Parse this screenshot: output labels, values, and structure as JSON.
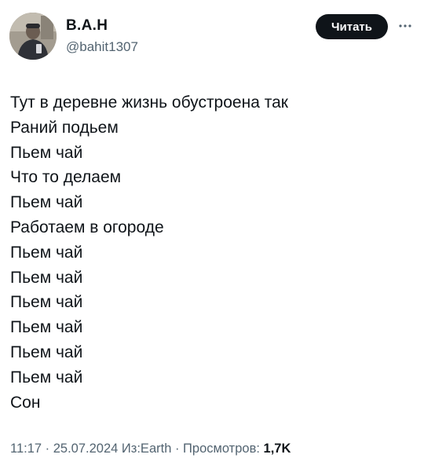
{
  "author": {
    "display_name": "В.А.Н",
    "handle": "@bahit1307",
    "avatar_icon": "user-avatar-photo"
  },
  "header": {
    "follow_label": "Читать",
    "more_icon": "more-dots-icon"
  },
  "tweet": {
    "lines": [
      "Тут в деревне жизнь обустроена так",
      "Раний подьем",
      "Пьем чай",
      "Что то делаем",
      "Пьем чай",
      "Работаем в огороде",
      "Пьем чай",
      "Пьем чай",
      "Пьем чай",
      "Пьем чай",
      "Пьем чай",
      "Пьем чай",
      "Сон"
    ]
  },
  "meta": {
    "time": "11:17",
    "separator1": " · ",
    "date": "25.07.2024",
    "location": " Из:Earth",
    "separator2": " · ",
    "views_label": "Просмотров: ",
    "views_count": "1,7K"
  },
  "colors": {
    "text_primary": "#0f1419",
    "text_secondary": "#536471",
    "button_bg": "#0f1419",
    "button_text": "#ffffff"
  }
}
